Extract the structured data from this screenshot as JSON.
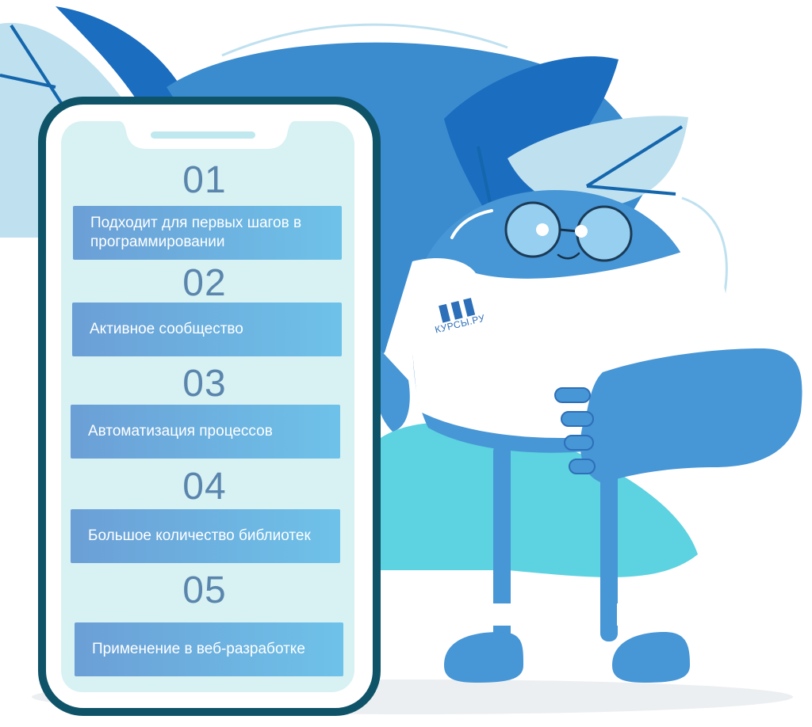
{
  "steps": [
    {
      "number": "01",
      "text": "Подходит для первых шагов в программировании"
    },
    {
      "number": "02",
      "text": "Активное сообщество"
    },
    {
      "number": "03",
      "text": "Автоматизация процессов"
    },
    {
      "number": "04",
      "text": "Большое количество библиотек"
    },
    {
      "number": "05",
      "text": "Применение в веб-разработке"
    }
  ],
  "mascot": {
    "logo_text": "КУРСЫ.РУ"
  },
  "colors": {
    "phone_frame": "#0f5368",
    "screen": "#d8f1f3",
    "item_start": "#6b9fd6",
    "item_end": "#6ec2e9",
    "number": "#5a86ad",
    "mascot_body": "#4796d6"
  }
}
